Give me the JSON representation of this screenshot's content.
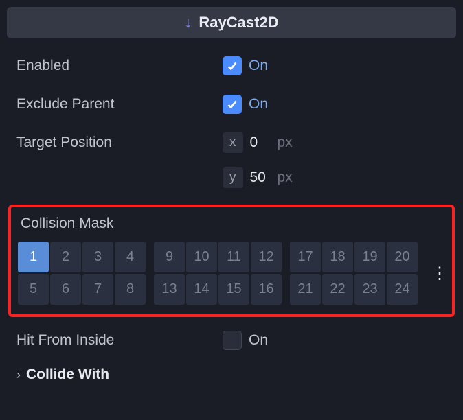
{
  "header": {
    "title": "RayCast2D",
    "icon": "arrow-down-icon"
  },
  "enabled": {
    "label": "Enabled",
    "on_label": "On",
    "checked": true
  },
  "exclude_parent": {
    "label": "Exclude Parent",
    "on_label": "On",
    "checked": true
  },
  "target_position": {
    "label": "Target Position",
    "x": {
      "axis": "x",
      "value": "0",
      "unit": "px"
    },
    "y": {
      "axis": "y",
      "value": "50",
      "unit": "px"
    }
  },
  "collision_mask": {
    "label": "Collision Mask",
    "groups": [
      [
        1,
        2,
        3,
        4,
        5,
        6,
        7,
        8
      ],
      [
        9,
        10,
        11,
        12,
        13,
        14,
        15,
        16
      ],
      [
        17,
        18,
        19,
        20,
        21,
        22,
        23,
        24
      ]
    ],
    "selected": [
      1
    ]
  },
  "hit_from_inside": {
    "label": "Hit From Inside",
    "on_label": "On",
    "checked": false
  },
  "collide_with": {
    "label": "Collide With"
  }
}
